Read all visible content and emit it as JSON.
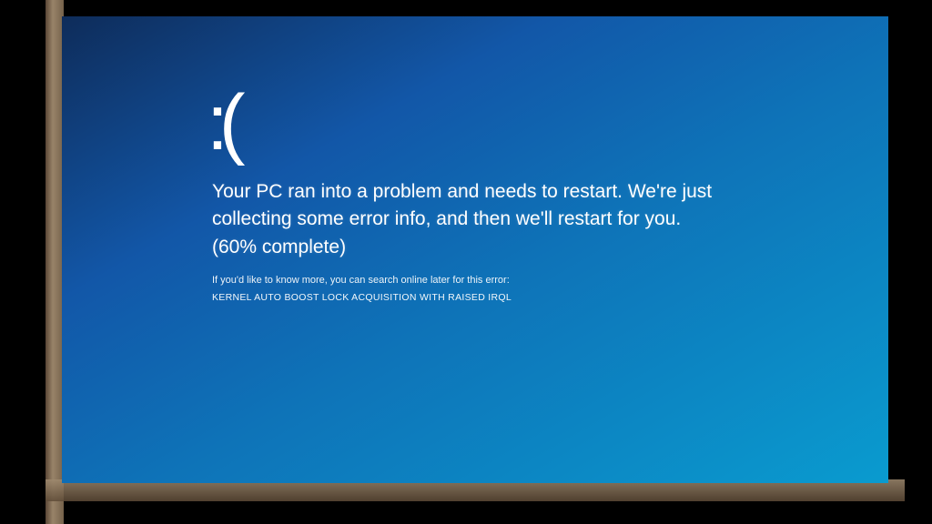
{
  "bsod": {
    "emoticon": ":(",
    "message": "Your PC ran into a problem and needs to restart. We're just collecting some error info, and then we'll restart for you. (60% complete)",
    "hint": "If you'd like to know more, you can search online later for this error:",
    "error_code": "KERNEL AUTO BOOST LOCK ACQUISITION WITH RAISED IRQL"
  }
}
